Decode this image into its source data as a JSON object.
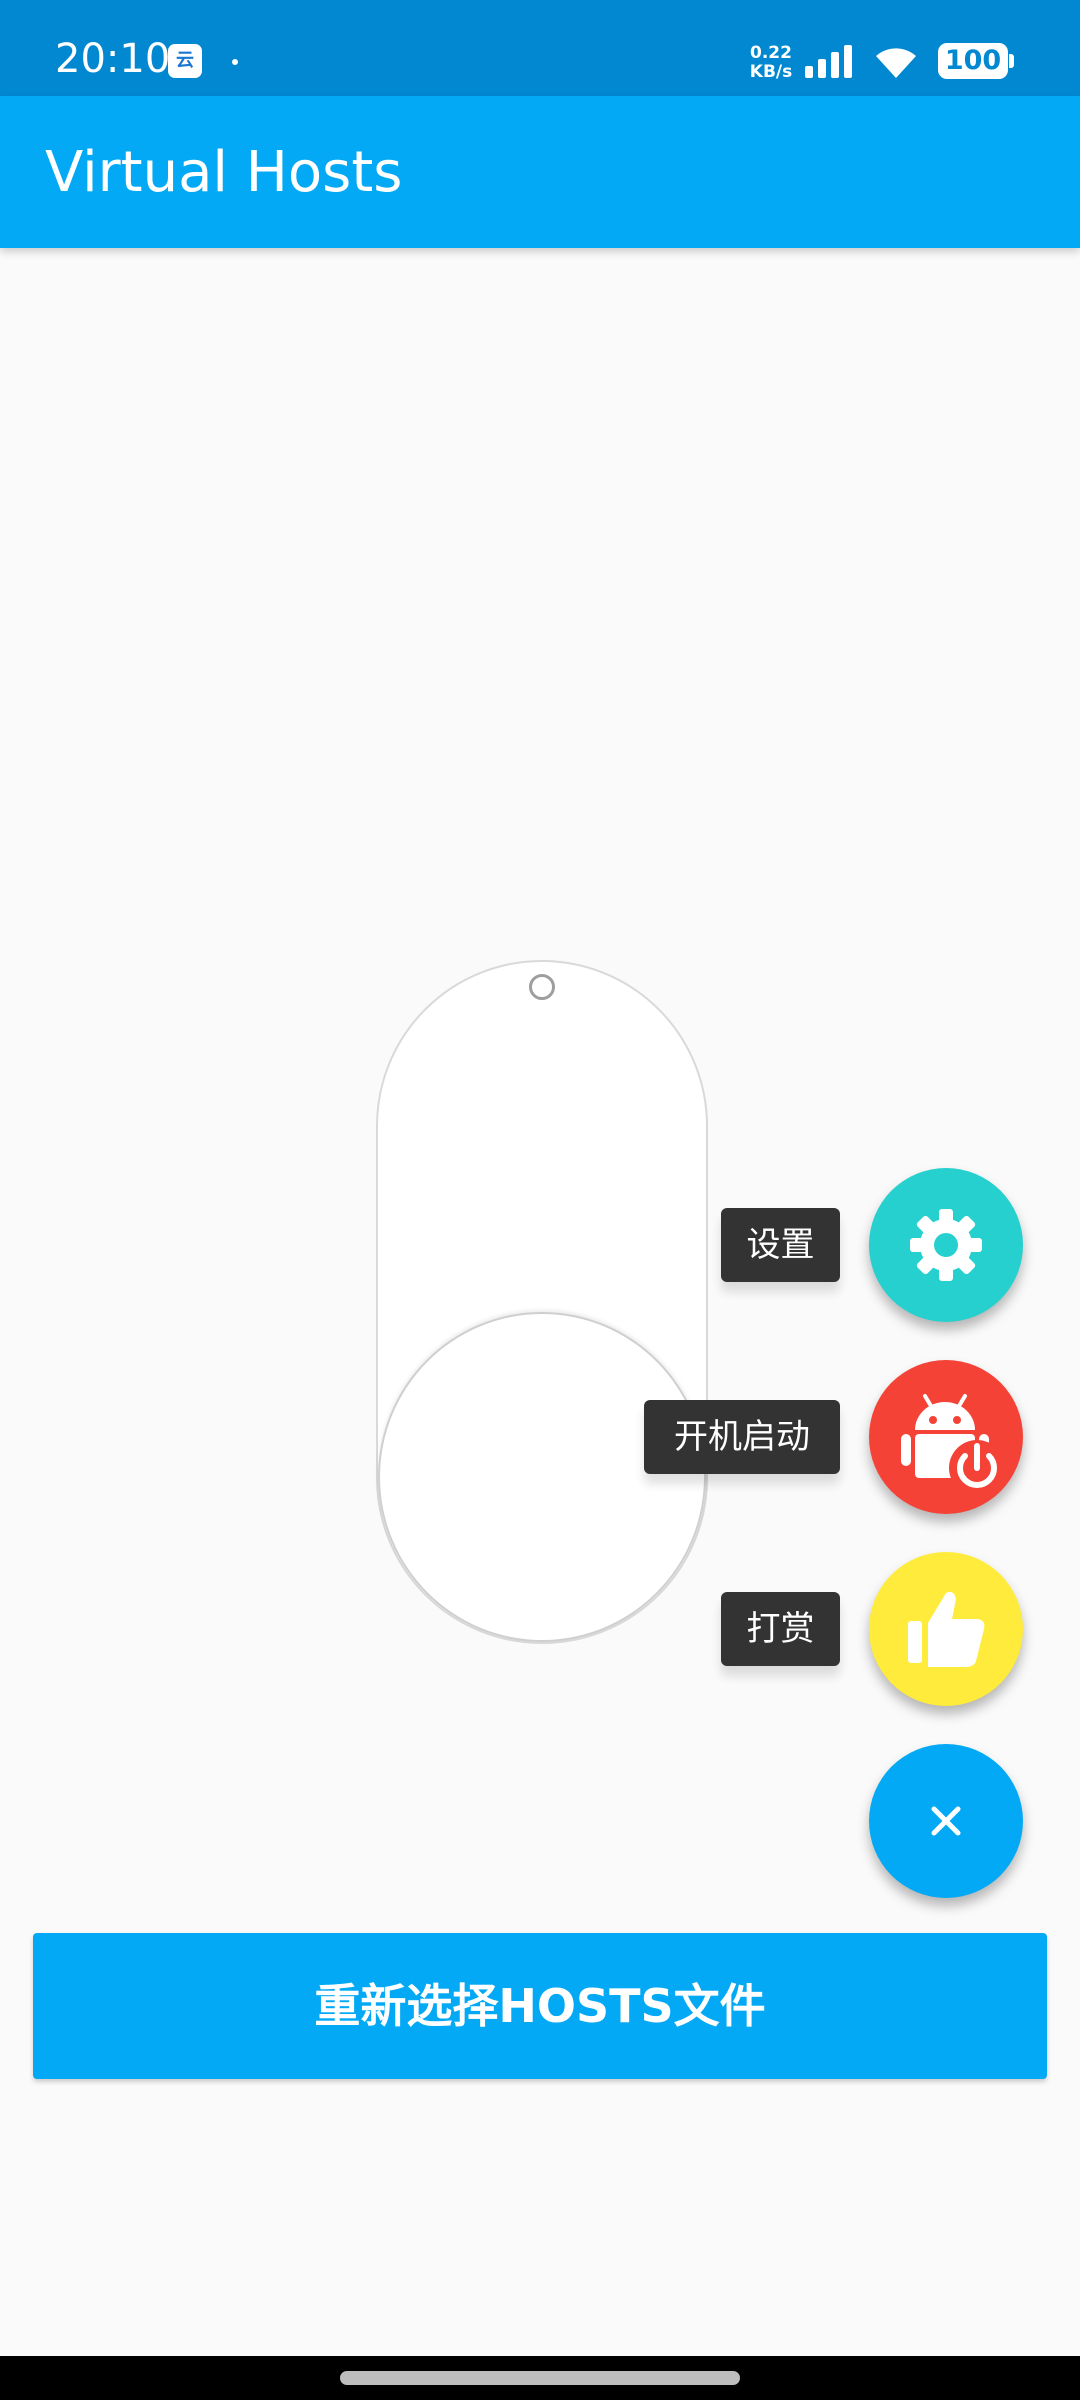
{
  "status_bar": {
    "time": "20:10",
    "app_icon_glyph": "云",
    "net_speed_value": "0.22",
    "net_speed_unit": "KB/s",
    "battery": "100",
    "icons": [
      "signal-icon",
      "wifi-icon",
      "battery-icon"
    ]
  },
  "app_bar": {
    "title": "Virtual Hosts",
    "color": "#03a9f4"
  },
  "toggle": {
    "state": "off"
  },
  "fab_menu": {
    "items": [
      {
        "label": "设置",
        "icon": "gear-icon",
        "color": "#26d0ce"
      },
      {
        "label": "开机启动",
        "icon": "android-power-icon",
        "color": "#f44336"
      },
      {
        "label": "打赏",
        "icon": "thumbs-up-icon",
        "color": "#ffeb3b"
      }
    ],
    "close_icon": "close-icon",
    "close_color": "#03a9f4"
  },
  "bottom_button": {
    "label": "重新选择HOSTS文件"
  }
}
